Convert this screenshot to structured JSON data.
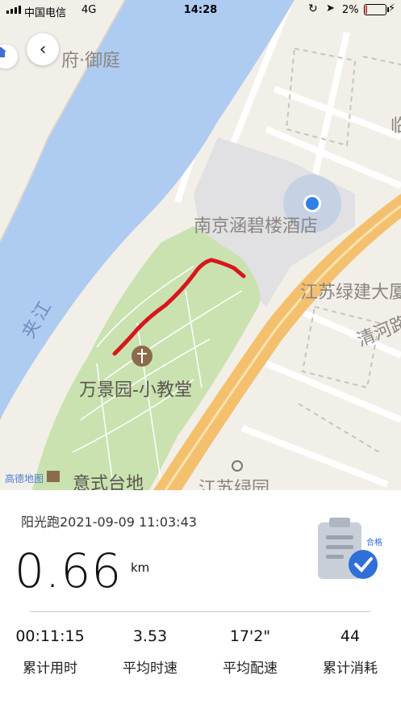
{
  "status_bar": {
    "carrier": "中国电信",
    "network": "4G",
    "time": "14:28",
    "battery": "2%"
  },
  "map": {
    "labels": {
      "top_estate": "府·御庭",
      "top_right": "临",
      "hotel": "南京涵碧楼酒店",
      "building": "江苏绿建大厦",
      "road": "清河路",
      "river": "夹江",
      "church": "万景园-小教堂",
      "bottom_left": "意式台地",
      "bottom_right": "江苏绿园"
    },
    "watermark": "高德地图",
    "colors": {
      "water": "#aecbf2",
      "park": "#c9e2b0",
      "route": "#d8161d",
      "highway": "#f4c06d"
    }
  },
  "summary": {
    "session_title": "阳光跑2021-09-09 11:03:43",
    "distance": "0.66",
    "distance_unit": "km",
    "badge_label": "合格",
    "stats": [
      {
        "value": "00:11:15",
        "label": "累计用时"
      },
      {
        "value": "3.53",
        "label": "平均时速"
      },
      {
        "value": "17'2\"",
        "label": "平均配速"
      },
      {
        "value": "44",
        "label": "累计消耗"
      }
    ]
  }
}
